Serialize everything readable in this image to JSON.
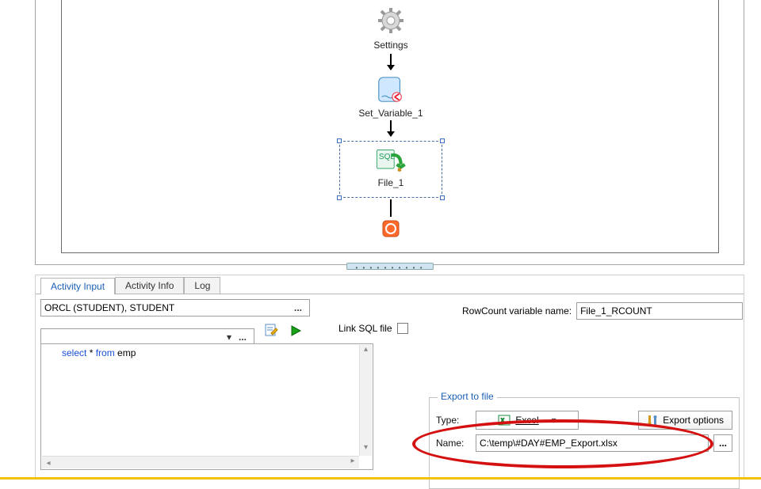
{
  "flow": {
    "settings_label": "Settings",
    "set_variable_label": "Set_Variable_1",
    "file_label": "File_1"
  },
  "tabs": {
    "activity_input": "Activity Input",
    "activity_info": "Activity Info",
    "log": "Log"
  },
  "connection": {
    "value": "ORCL (STUDENT), STUDENT"
  },
  "link_sql": {
    "label": "Link SQL file"
  },
  "rowcount": {
    "label": "RowCount variable name:",
    "value": "File_1_RCOUNT"
  },
  "sql": {
    "kw_select": "select",
    "star": " * ",
    "kw_from": "from",
    "table": " emp"
  },
  "export": {
    "legend": "Export to file",
    "type_label": "Type:",
    "type_value": "Excel",
    "export_options": "Export options",
    "name_label": "Name:",
    "name_value": "C:\\temp\\#DAY#EMP_Export.xlsx",
    "ellipsis": "..."
  },
  "glyphs": {
    "ellipsis": "...",
    "dropdown": "▾"
  }
}
